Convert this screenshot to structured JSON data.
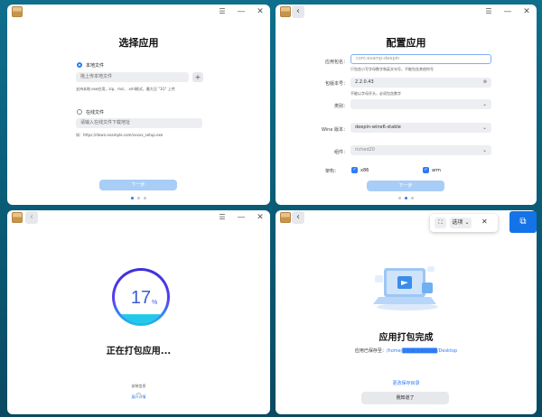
{
  "panel1": {
    "title": "选择应用",
    "local_option": "本地文件",
    "local_placeholder": "拖上传本地文件",
    "local_hint": "支持本地.exe应用，zip、msi、.xml格式，最大压 \"1G\" 上传",
    "online_option": "在线文件",
    "online_placeholder": "请输入在线文件下载地址",
    "online_hint": "如：https://down.example.com/xxxxx_setup.exe",
    "next": "下一步",
    "add_icon": "+"
  },
  "panel2": {
    "title": "配置应用",
    "labels": {
      "package_name": "应用包名：",
      "version": "包版本号：",
      "category": "类别：",
      "wine": "Wine 版本：",
      "component": "组件：",
      "arch": "架构："
    },
    "package_placeholder": "com.examp-deepin",
    "package_hint": "只包含小写字母数字和英文句号，不能包含其他符号",
    "version_value": "2.2.0.43",
    "version_hint": "不能以字母开头，必须包含数字",
    "category_value": "",
    "wine_value": "deepin-wine6-stable",
    "component_value": "riched20",
    "arch_x86": "x86",
    "arch_arm": "arm",
    "next": "下一步"
  },
  "panel3": {
    "progress_number": "17",
    "progress_unit": "%",
    "progress_fraction": 0.17,
    "status": "正在打包应用...",
    "detail_label": "安装信息",
    "expand": "展开详情"
  },
  "panel4": {
    "title": "应用打包完成",
    "saved_label": "应用已保存至：",
    "saved_path": "/home/██████████/Desktop",
    "change_dir": "更改保存目录",
    "ok": "我知道了",
    "toolbar_option": "选项"
  },
  "colors": {
    "accent": "#2d7bf6",
    "disabled_button": "#a8cdf7",
    "ring_start": "#3d2fd8",
    "ring_end": "#16c4e8"
  }
}
